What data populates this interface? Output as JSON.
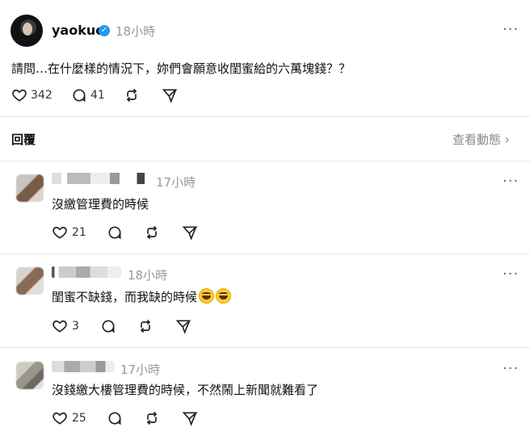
{
  "post": {
    "username": "yaokuo",
    "time": "18小時",
    "more": "···",
    "text": "請問…在什麼樣的情況下，妳們會願意收閨蜜給的六萬塊錢？？",
    "likes": "342",
    "comments": "41"
  },
  "replies_header": {
    "title": "回覆",
    "activity": "查看動態 ›"
  },
  "replies": [
    {
      "time": "17小時",
      "text": "沒繳管理費的時候",
      "likes": "21"
    },
    {
      "time": "18小時",
      "text": "閨蜜不缺錢，而我缺的時候",
      "likes": "3"
    },
    {
      "time": "17小時",
      "text": "沒錢繳大樓管理費的時候，不然鬧上新聞就難看了",
      "likes": "25"
    }
  ],
  "colors": {
    "verified": "#1d9bf0",
    "muted": "#999999",
    "divider": "#e6e6e6"
  }
}
